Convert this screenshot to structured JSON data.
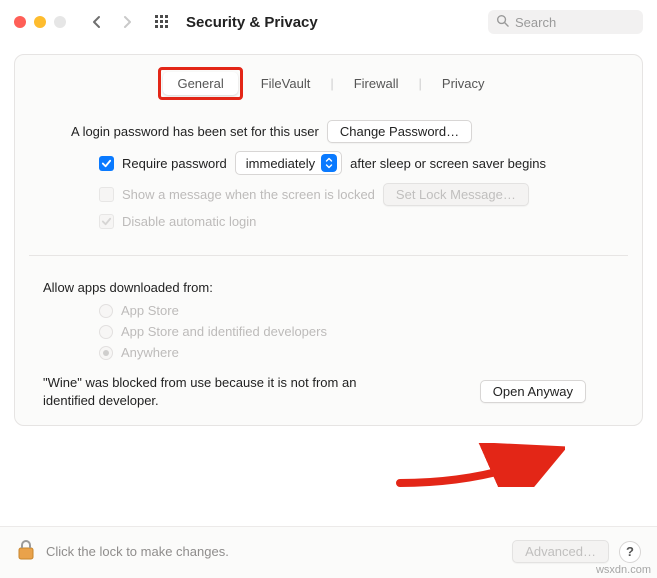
{
  "titlebar": {
    "title": "Security & Privacy",
    "search_placeholder": "Search"
  },
  "tabs": {
    "general": "General",
    "filevault": "FileVault",
    "firewall": "Firewall",
    "privacy": "Privacy"
  },
  "login": {
    "password_set": "A login password has been set for this user",
    "change_password": "Change Password…",
    "require_password_pre": "Require password",
    "require_password_select": "immediately",
    "require_password_post": "after sleep or screen saver begins",
    "show_message": "Show a message when the screen is locked",
    "set_lock_message": "Set Lock Message…",
    "disable_auto_login": "Disable automatic login"
  },
  "allow_apps": {
    "heading": "Allow apps downloaded from:",
    "app_store": "App Store",
    "identified": "App Store and identified developers",
    "anywhere": "Anywhere"
  },
  "blocked": {
    "message": "\"Wine\" was blocked from use because it is not from an identified developer.",
    "open_anyway": "Open Anyway"
  },
  "footer": {
    "lock_text": "Click the lock to make changes.",
    "advanced": "Advanced…",
    "help": "?"
  },
  "watermark": "wsxdn.com",
  "colors": {
    "accent": "#0a7aff",
    "highlight": "#e32617"
  }
}
